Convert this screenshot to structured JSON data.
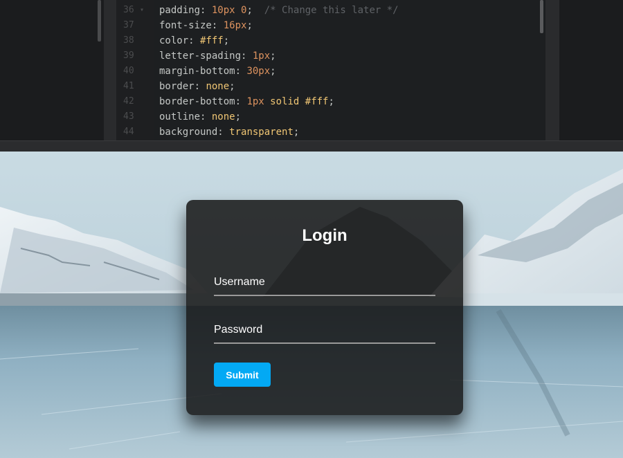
{
  "editor": {
    "lines": [
      {
        "num": "36",
        "fold": "▾",
        "tokens": [
          {
            "t": "padding",
            "c": "prop"
          },
          {
            "t": ": ",
            "c": "punc"
          },
          {
            "t": "10px 0",
            "c": "num"
          },
          {
            "t": ";  ",
            "c": "punc"
          },
          {
            "t": "/* Change this later */",
            "c": "cmt"
          }
        ]
      },
      {
        "num": "37",
        "fold": "",
        "tokens": [
          {
            "t": "font-size",
            "c": "prop"
          },
          {
            "t": ": ",
            "c": "punc"
          },
          {
            "t": "16px",
            "c": "num"
          },
          {
            "t": ";",
            "c": "punc"
          }
        ]
      },
      {
        "num": "38",
        "fold": "",
        "tokens": [
          {
            "t": "color",
            "c": "prop"
          },
          {
            "t": ": ",
            "c": "punc"
          },
          {
            "t": "#fff",
            "c": "kw"
          },
          {
            "t": ";",
            "c": "punc"
          }
        ]
      },
      {
        "num": "39",
        "fold": "",
        "tokens": [
          {
            "t": "letter-spading",
            "c": "prop"
          },
          {
            "t": ": ",
            "c": "punc"
          },
          {
            "t": "1px",
            "c": "num"
          },
          {
            "t": ";",
            "c": "punc"
          }
        ]
      },
      {
        "num": "40",
        "fold": "",
        "tokens": [
          {
            "t": "margin-bottom",
            "c": "prop"
          },
          {
            "t": ": ",
            "c": "punc"
          },
          {
            "t": "30px",
            "c": "num"
          },
          {
            "t": ";",
            "c": "punc"
          }
        ]
      },
      {
        "num": "41",
        "fold": "",
        "tokens": [
          {
            "t": "border",
            "c": "prop"
          },
          {
            "t": ": ",
            "c": "punc"
          },
          {
            "t": "none",
            "c": "kw"
          },
          {
            "t": ";",
            "c": "punc"
          }
        ]
      },
      {
        "num": "42",
        "fold": "",
        "tokens": [
          {
            "t": "border-bottom",
            "c": "prop"
          },
          {
            "t": ": ",
            "c": "punc"
          },
          {
            "t": "1px",
            "c": "num"
          },
          {
            "t": " ",
            "c": "punc"
          },
          {
            "t": "solid",
            "c": "kw"
          },
          {
            "t": " ",
            "c": "punc"
          },
          {
            "t": "#fff",
            "c": "kw"
          },
          {
            "t": ";",
            "c": "punc"
          }
        ]
      },
      {
        "num": "43",
        "fold": "",
        "tokens": [
          {
            "t": "outline",
            "c": "prop"
          },
          {
            "t": ": ",
            "c": "punc"
          },
          {
            "t": "none",
            "c": "kw"
          },
          {
            "t": ";",
            "c": "punc"
          }
        ]
      },
      {
        "num": "44",
        "fold": "",
        "tokens": [
          {
            "t": "background",
            "c": "prop"
          },
          {
            "t": ": ",
            "c": "punc"
          },
          {
            "t": "transparent",
            "c": "kw"
          },
          {
            "t": ";",
            "c": "punc"
          }
        ]
      }
    ]
  },
  "login": {
    "title": "Login",
    "username_label": "Username",
    "password_label": "Password",
    "submit_label": "Submit"
  },
  "colors": {
    "submit_bg": "#03a9f4",
    "card_bg": "rgba(22,22,22,0.86)",
    "editor_bg": "#1d1f21"
  }
}
